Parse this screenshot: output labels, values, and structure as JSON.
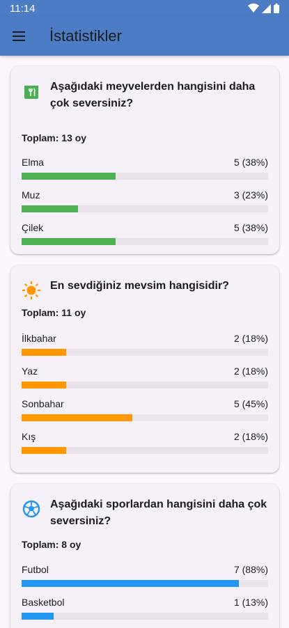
{
  "status": {
    "time": "11:14"
  },
  "appbar": {
    "title": "İstatistikler",
    "menu_icon": "menu-icon"
  },
  "polls": [
    {
      "question": "Aşağıdaki meyvelerden hangisini daha çok seversiniz?",
      "icon": "restaurant-icon",
      "color": "#4caf50",
      "total": "Toplam: 13 oy",
      "options": [
        {
          "label": "Elma",
          "value": "5 (38%)",
          "fraction": 0.38
        },
        {
          "label": "Muz",
          "value": "3 (23%)",
          "fraction": 0.23
        },
        {
          "label": "Çilek",
          "value": "5 (38%)",
          "fraction": 0.38
        }
      ]
    },
    {
      "question": "En sevdiğiniz mevsim hangisidir?",
      "icon": "sun-icon",
      "color": "#ff9800",
      "total": "Toplam: 11 oy",
      "options": [
        {
          "label": "İlkbahar",
          "value": "2 (18%)",
          "fraction": 0.18
        },
        {
          "label": "Yaz",
          "value": "2 (18%)",
          "fraction": 0.18
        },
        {
          "label": "Sonbahar",
          "value": "5 (45%)",
          "fraction": 0.45
        },
        {
          "label": "Kış",
          "value": "2 (18%)",
          "fraction": 0.18
        }
      ]
    },
    {
      "question": "Aşağıdaki sporlardan hangisini daha çok seversiniz?",
      "icon": "soccer-ball-icon",
      "color": "#2196f3",
      "total": "Toplam: 8 oy",
      "options": [
        {
          "label": "Futbol",
          "value": "7 (88%)",
          "fraction": 0.88
        },
        {
          "label": "Basketbol",
          "value": "1 (13%)",
          "fraction": 0.13
        }
      ]
    }
  ]
}
